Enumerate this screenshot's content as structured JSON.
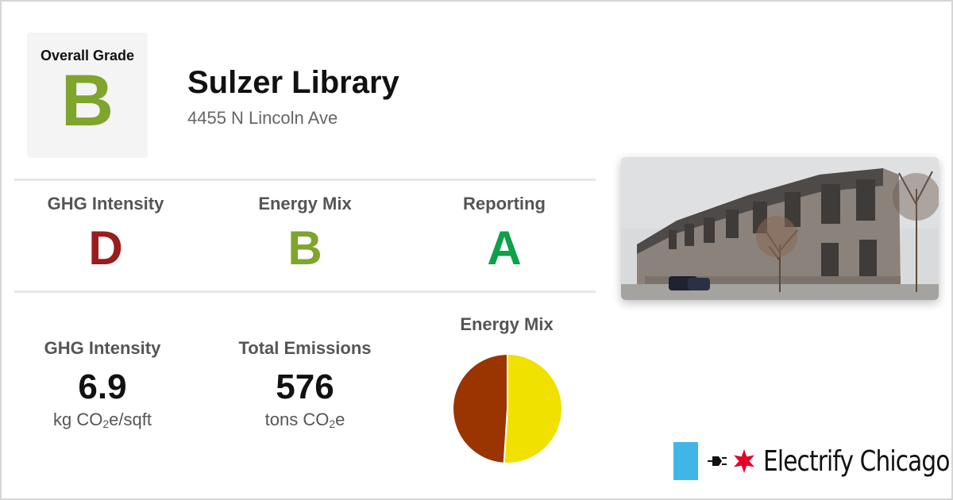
{
  "overall": {
    "label": "Overall Grade",
    "grade": "B",
    "color": "#7fa52c"
  },
  "building": {
    "name": "Sulzer Library",
    "address": "4455 N Lincoln Ave"
  },
  "grades": [
    {
      "title": "GHG Intensity",
      "letter": "D",
      "color": "#9b1c1c"
    },
    {
      "title": "Energy Mix",
      "letter": "B",
      "color": "#7fa52c"
    },
    {
      "title": "Reporting",
      "letter": "A",
      "color": "#0fa04a"
    }
  ],
  "stats": [
    {
      "title": "GHG Intensity",
      "value": "6.9",
      "unit_prefix": "kg CO",
      "unit_sub": "2",
      "unit_suffix": "e/sqft"
    },
    {
      "title": "Total Emissions",
      "value": "576",
      "unit_prefix": "tons CO",
      "unit_sub": "2",
      "unit_suffix": "e"
    }
  ],
  "energy_mix": {
    "title": "Energy Mix",
    "slices": [
      {
        "share": 0.51,
        "color": "#f0e100"
      },
      {
        "share": 0.49,
        "color": "#9a3400"
      }
    ]
  },
  "logo": {
    "text": "Electrify Chicago",
    "flag_color": "#41b6e6",
    "star_color": "#e4002b"
  }
}
